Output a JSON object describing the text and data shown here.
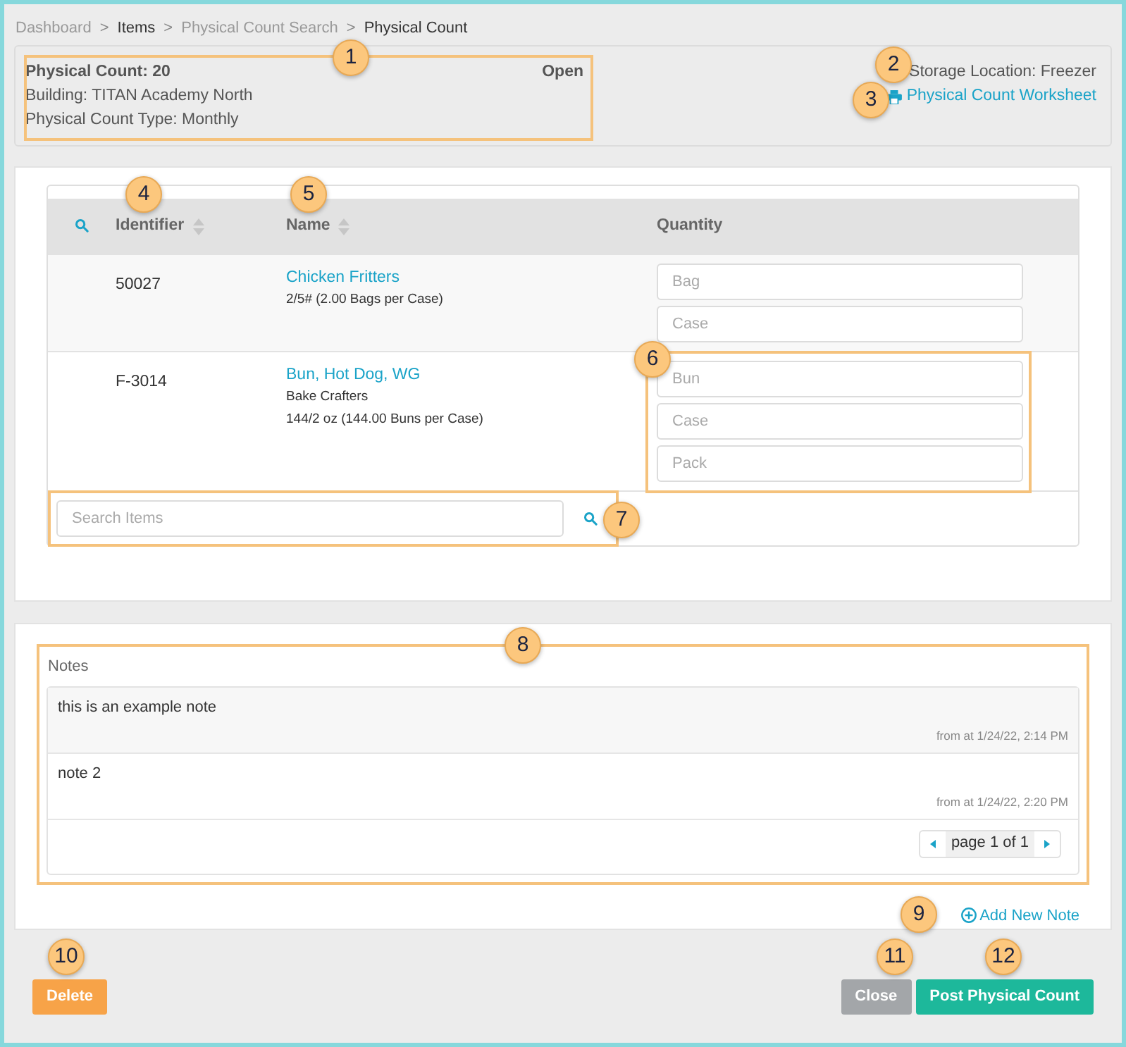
{
  "breadcrumb": [
    {
      "label": "Dashboard",
      "emphasized": false
    },
    {
      "separator": ">",
      "label": "Items",
      "emphasized": true
    },
    {
      "separator": ">",
      "label": "Physical Count Search",
      "emphasized": false
    },
    {
      "separator": ">",
      "label": "Physical Count",
      "emphasized": true
    }
  ],
  "header": {
    "title": "Physical Count: 20",
    "status": "Open",
    "building": "Building: TITAN Academy North",
    "type": "Physical Count Type: Monthly",
    "storage_location": "Storage Location: Freezer",
    "worksheet_link": "Physical Count Worksheet"
  },
  "table": {
    "columns": [
      {
        "label": "Identifier",
        "sortable": true
      },
      {
        "label": "Name",
        "sortable": true
      },
      {
        "label": "Quantity",
        "sortable": false
      }
    ],
    "rows": [
      {
        "identifier": "50027",
        "name": "Chicken Fritters",
        "details": [
          "2/5# (2.00 Bags per Case)"
        ],
        "quantity_fields": [
          {
            "placeholder": "Bag"
          },
          {
            "placeholder": "Case"
          }
        ]
      },
      {
        "identifier": "F-3014",
        "name": "Bun, Hot Dog, WG",
        "details": [
          "Bake Crafters",
          "144/2 oz (144.00 Buns per Case)"
        ],
        "quantity_fields": [
          {
            "placeholder": "Bun"
          },
          {
            "placeholder": "Case"
          },
          {
            "placeholder": "Pack"
          }
        ]
      }
    ],
    "search": {
      "placeholder": "Search Items"
    }
  },
  "notes": {
    "label": "Notes",
    "items": [
      {
        "text": "this is an example note",
        "meta": "from at 1/24/22, 2:14 PM"
      },
      {
        "text": "note 2",
        "meta": "from at 1/24/22, 2:20 PM"
      }
    ],
    "pagination": "page 1 of 1",
    "add_link": "Add New Note"
  },
  "buttons": [
    {
      "label": "Delete",
      "kind": "danger"
    },
    {
      "label": "Close",
      "kind": "secondary"
    },
    {
      "label": "Post Physical Count",
      "kind": "primary"
    }
  ],
  "callouts": [
    {
      "label": "1"
    },
    {
      "label": "2"
    },
    {
      "label": "3"
    },
    {
      "label": "4"
    },
    {
      "label": "5"
    },
    {
      "label": "6"
    },
    {
      "label": "7"
    },
    {
      "label": "8"
    },
    {
      "label": "9"
    },
    {
      "label": "10"
    },
    {
      "label": "11"
    },
    {
      "label": "12"
    }
  ]
}
